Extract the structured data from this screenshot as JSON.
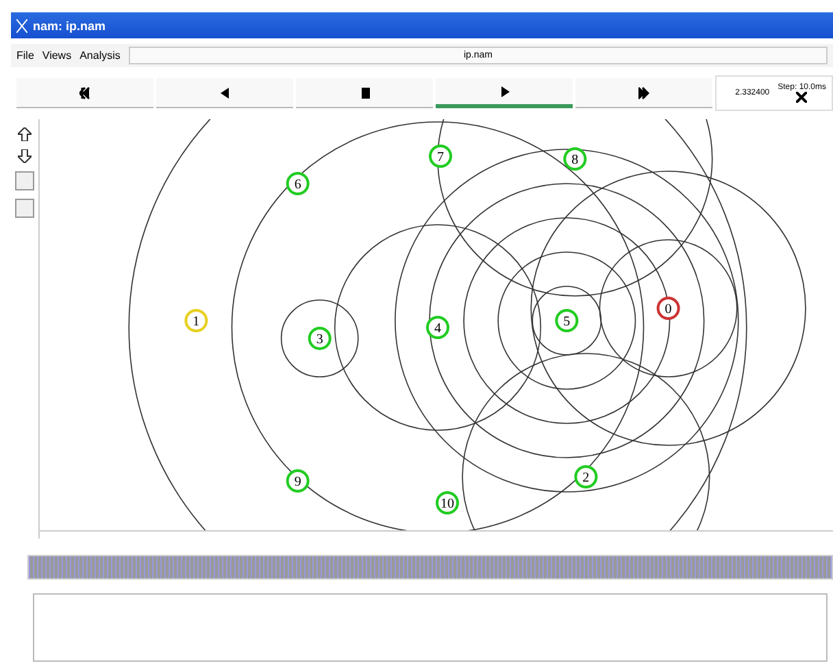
{
  "window": {
    "title": "nam: ip.nam"
  },
  "menu": [
    "File",
    "Views",
    "Analysis"
  ],
  "file_name": "ip.nam",
  "controls": [
    {
      "kind": "rewind",
      "selected": false
    },
    {
      "kind": "back",
      "selected": false
    },
    {
      "kind": "stop",
      "selected": false
    },
    {
      "kind": "play",
      "selected": true
    },
    {
      "kind": "forward",
      "selected": false
    }
  ],
  "time": "2.332400",
  "step": "Step: 10.0ms",
  "nodes": [
    {
      "label": "0",
      "color": "#cc3333"
    },
    {
      "label": "1",
      "color": "#e8d020"
    },
    {
      "label": "2",
      "color": "#22cc22"
    },
    {
      "label": "3",
      "color": "#22cc22"
    },
    {
      "label": "4",
      "color": "#22cc22"
    },
    {
      "label": "5",
      "color": "#22cc22"
    },
    {
      "label": "6",
      "color": "#22cc22"
    },
    {
      "label": "7",
      "color": "#22cc22"
    },
    {
      "label": "8",
      "color": "#22cc22"
    },
    {
      "label": "9",
      "color": "#22cc22"
    },
    {
      "label": "10",
      "color": "#22cc22"
    }
  ]
}
